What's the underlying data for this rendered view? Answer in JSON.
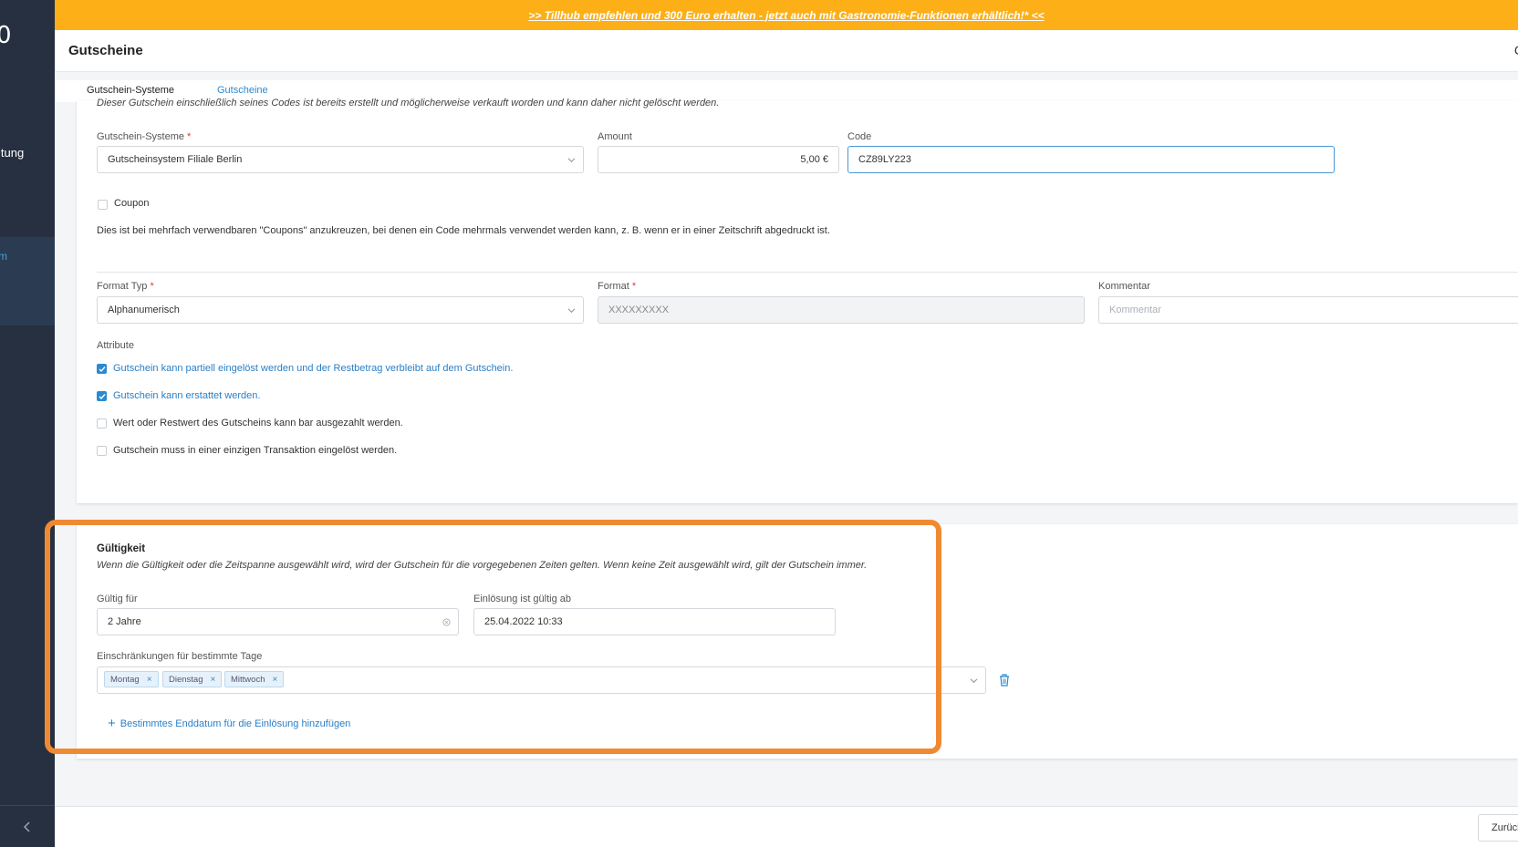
{
  "sidebar": {
    "logo_fragment": "0",
    "item_fragment": "ltung",
    "active_fragment": "m"
  },
  "banner": {
    "text": ">> Tillhub empfehlen und 300 Euro erhalten - jetzt auch mit Gastronomie-Funktionen erhältlich!* <<"
  },
  "header": {
    "title": "Gutscheine",
    "right_fragment": "C"
  },
  "tabs": [
    "Gutschein-Systeme",
    "Gutscheine"
  ],
  "form": {
    "notice": "Dieser Gutschein einschließlich seines Codes ist bereits erstellt und möglicherweise verkauft worden und kann daher nicht gelöscht werden.",
    "system": {
      "label": "Gutschein-Systeme",
      "value": "Gutscheinsystem Filiale Berlin"
    },
    "amount": {
      "label": "Amount",
      "value": "5,00 €"
    },
    "code": {
      "label": "Code",
      "value": "CZ89LY223"
    },
    "coupon": {
      "label": "Coupon",
      "checked": false,
      "help": "Dies ist bei mehrfach verwendbaren \"Coupons\" anzukreuzen, bei denen ein Code mehrmals verwendet werden kann, z. B. wenn er in einer Zeitschrift abgedruckt ist."
    },
    "format_type": {
      "label": "Format Typ",
      "value": "Alphanumerisch"
    },
    "format": {
      "label": "Format",
      "value": "XXXXXXXXX"
    },
    "comment": {
      "label": "Kommentar",
      "placeholder": "Kommentar"
    },
    "attributes_label": "Attribute",
    "attributes": [
      {
        "label": "Gutschein kann partiell eingelöst werden und der Restbetrag verbleibt auf dem Gutschein.",
        "checked": true
      },
      {
        "label": "Gutschein kann erstattet werden.",
        "checked": true
      },
      {
        "label": "Wert oder Restwert des Gutscheins kann bar ausgezahlt werden.",
        "checked": false
      },
      {
        "label": "Gutschein muss in einer einzigen Transaktion eingelöst werden.",
        "checked": false
      }
    ]
  },
  "validity": {
    "title": "Gültigkeit",
    "description": "Wenn die Gültigkeit oder die Zeitspanne ausgewählt wird, wird der Gutschein für die vorgegebenen Zeiten gelten. Wenn keine Zeit ausgewählt wird, gilt der Gutschein immer.",
    "valid_for": {
      "label": "Gültig für",
      "value": "2 Jahre"
    },
    "redeem_from": {
      "label": "Einlösung ist gültig ab",
      "value": "25.04.2022 10:33"
    },
    "restrictions": {
      "label": "Einschränkungen für bestimmte Tage",
      "days": [
        "Montag",
        "Dienstag",
        "Mittwoch"
      ]
    },
    "add_end_date": "Bestimmtes Enddatum für die Einlösung hinzufügen"
  },
  "footer": {
    "back_button": "Zurück"
  },
  "colors": {
    "banner": "#fcaf17",
    "sidebar": "#263040",
    "accent": "#2a8ad1",
    "highlight": "#ef8a33"
  }
}
